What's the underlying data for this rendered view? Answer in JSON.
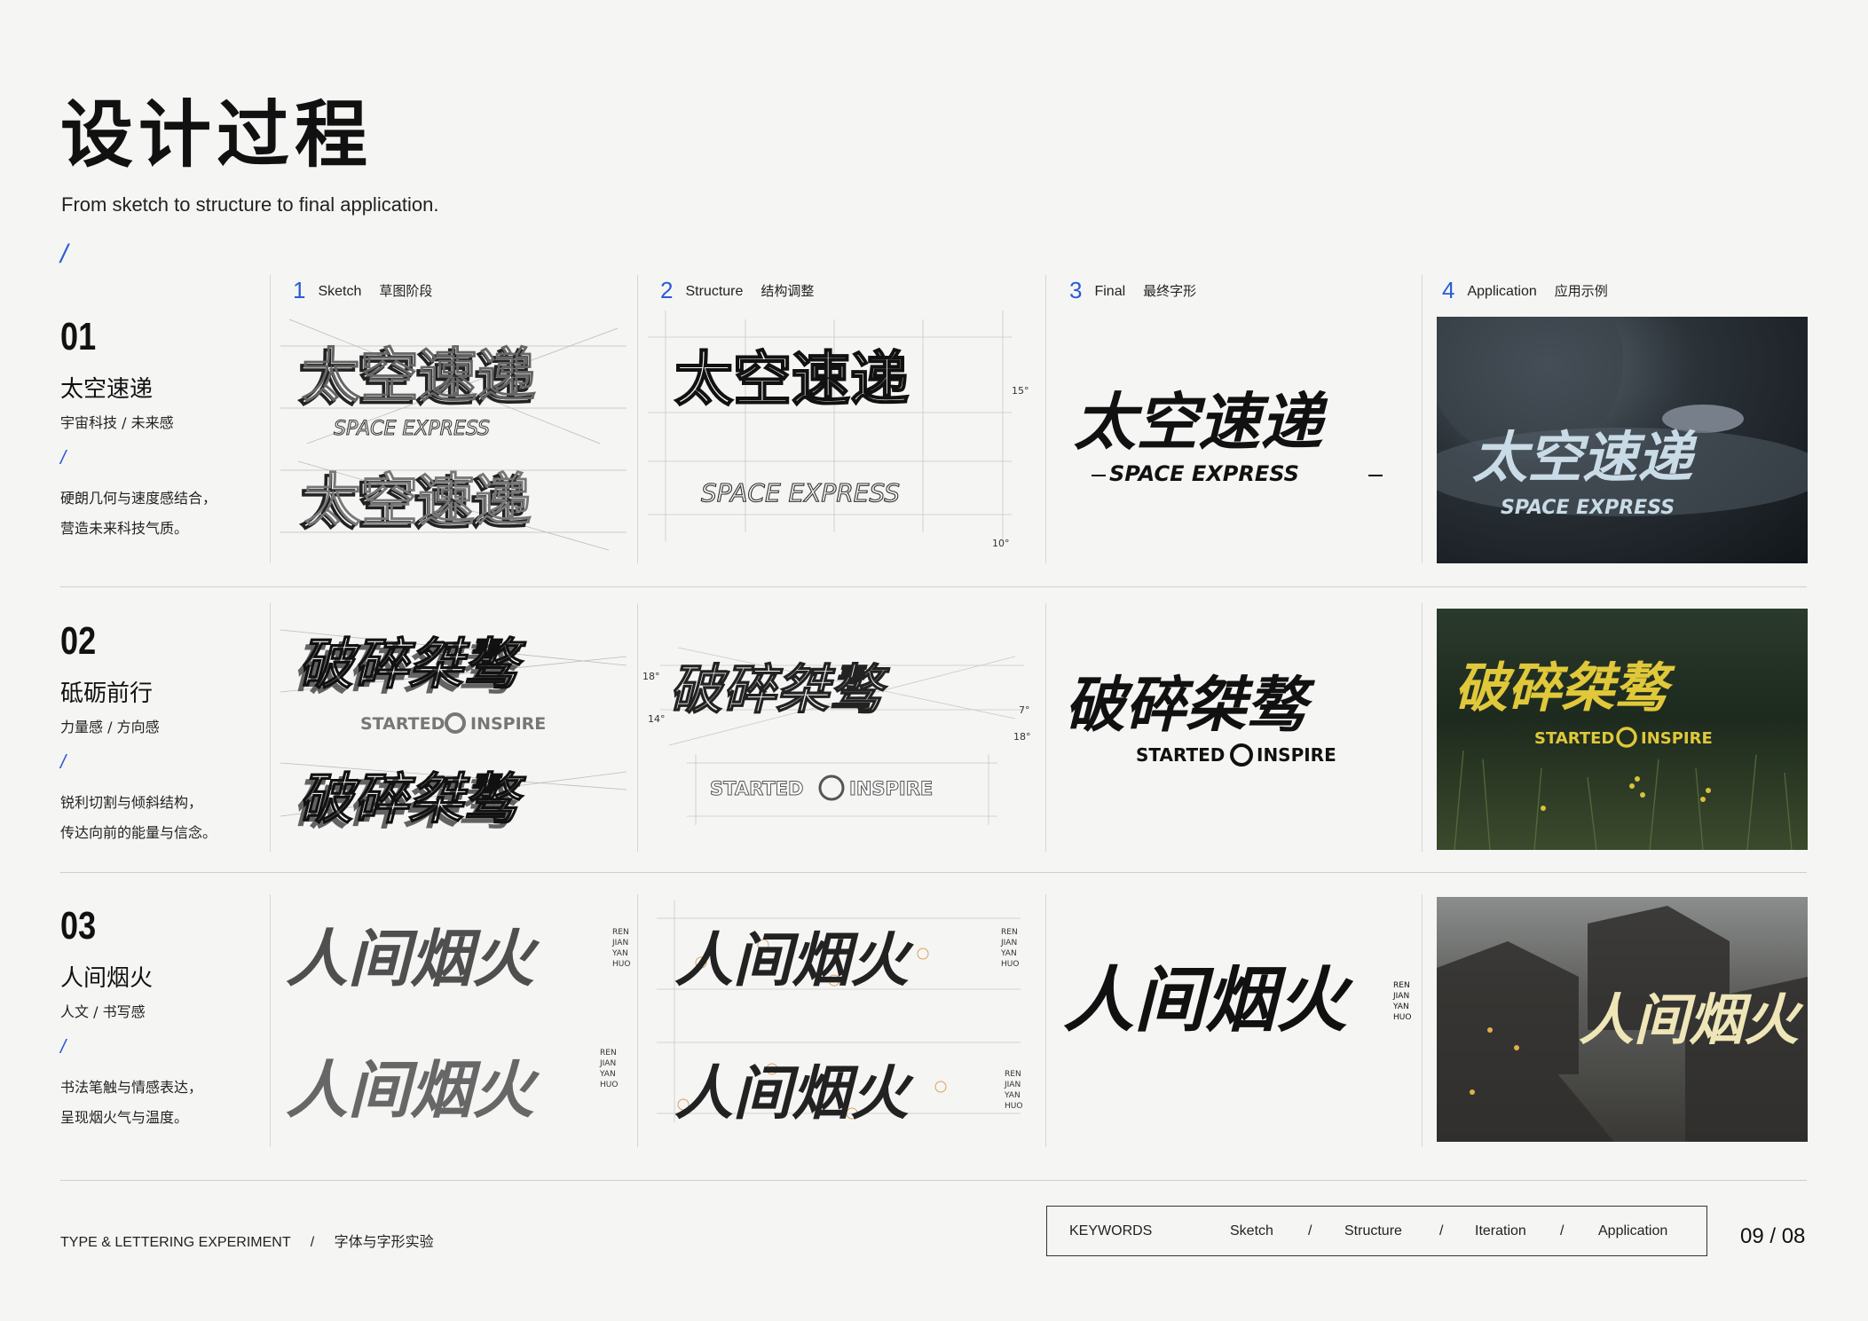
{
  "header": {
    "title": "设计过程",
    "subtitle": "From sketch to structure to final application.",
    "slash": "/"
  },
  "columns": [
    {
      "num": "1",
      "en": "Sketch",
      "cn": "草图阶段"
    },
    {
      "num": "2",
      "en": "Structure",
      "cn": "结构调整"
    },
    {
      "num": "3",
      "en": "Final",
      "cn": "最终字形"
    },
    {
      "num": "4",
      "en": "Application",
      "cn": "应用示例"
    }
  ],
  "rows": [
    {
      "num": "01",
      "name": "太空速递",
      "tags": "宇宙科技 / 未来感",
      "slash": "/",
      "desc1": "硬朗几何与速度感结合，",
      "desc2": "营造未来科技气质。",
      "logo": "太空速递",
      "sublogo": "SPACE EXPRESS",
      "angles": [
        "15°",
        "10°"
      ]
    },
    {
      "num": "02",
      "name": "砥砺前行",
      "tags": "力量感 / 方向感",
      "slash": "/",
      "desc1": "锐利切割与倾斜结构，",
      "desc2": "传达向前的能量与信念。",
      "logo": "破碎桀骜",
      "sublogo_left": "STARTED",
      "sublogo_right": "INSPIRE",
      "angles": [
        "18°",
        "14°",
        "7°",
        "18°"
      ]
    },
    {
      "num": "03",
      "name": "人间烟火",
      "tags": "人文 / 书写感",
      "slash": "/",
      "desc1": "书法笔触与情感表达，",
      "desc2": "呈现烟火气与温度。",
      "logo": "人间烟火",
      "pinyin": [
        "REN",
        "JIAN",
        "YAN",
        "HUO"
      ]
    }
  ],
  "footer": {
    "left": "TYPE & LETTERING EXPERIMENT",
    "sep": "/",
    "left_cn": "字体与字形实验",
    "keywords_label": "KEYWORDS",
    "keywords": [
      "Sketch",
      "Structure",
      "Iteration",
      "Application"
    ],
    "kw_sep": "/",
    "page": "09 / 08"
  },
  "colors": {
    "accent": "#2a5bd7",
    "ink": "#111111",
    "line": "#d6d6d6",
    "yellow": "#e0c83a",
    "cream": "#efe6b8"
  }
}
